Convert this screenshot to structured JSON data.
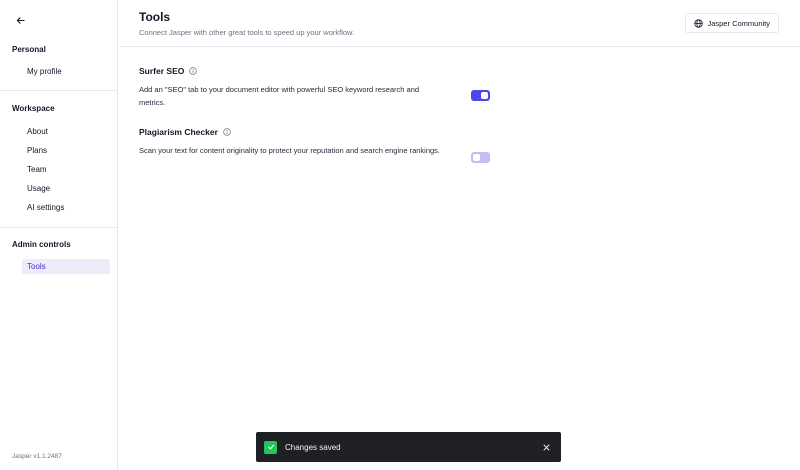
{
  "sidebar": {
    "back_icon": "arrow-left-icon",
    "sections": [
      {
        "title": "Personal",
        "items": [
          {
            "label": "My profile",
            "active": false
          }
        ]
      },
      {
        "title": "Workspace",
        "items": [
          {
            "label": "About",
            "active": false
          },
          {
            "label": "Plans",
            "active": false
          },
          {
            "label": "Team",
            "active": false
          },
          {
            "label": "Usage",
            "active": false
          },
          {
            "label": "AI settings",
            "active": false
          }
        ]
      },
      {
        "title": "Admin controls",
        "items": [
          {
            "label": "Tools",
            "active": true
          }
        ]
      }
    ],
    "version": "Jasper v1.1.2487"
  },
  "header": {
    "title": "Tools",
    "subtitle": "Connect Jasper with other great tools to speed up your workflow.",
    "community_button": {
      "label": "Jasper Community",
      "icon": "globe-icon"
    }
  },
  "tools": [
    {
      "name": "Surfer SEO",
      "info_icon": "info-icon",
      "description": "Add an \"SEO\" tab to your document editor with powerful SEO keyword research and metrics.",
      "enabled": true
    },
    {
      "name": "Plagiarism Checker",
      "info_icon": "info-icon",
      "description": "Scan your text for content originality to protect your reputation and search engine rankings.",
      "enabled": false
    }
  ],
  "toast": {
    "message": "Changes saved",
    "icon": "check-icon",
    "close_icon": "close-icon"
  },
  "colors": {
    "accent": "#4f46e5",
    "active_nav_bg": "#eeecfb",
    "toast_bg": "#1f2024",
    "success": "#22c55e"
  }
}
